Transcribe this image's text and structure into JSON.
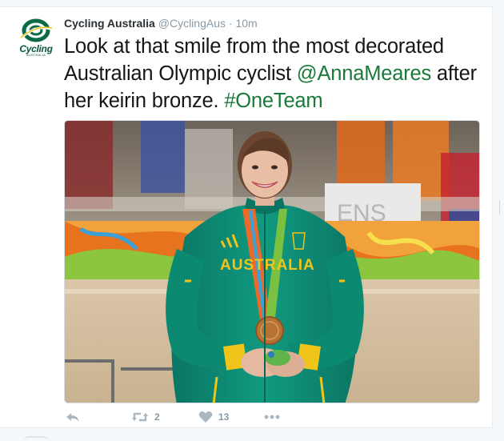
{
  "tweet": {
    "avatar_word": "Cycling",
    "avatar_sub": "AUSTRALIA",
    "name": "Cycling Australia",
    "handle": "@CyclingAus",
    "separator": "·",
    "time": "10m",
    "text_plain_1": "Look at that smile from the most decorated Australian Olympic cyclist ",
    "mention": "@AnnaMeares",
    "text_plain_2": " after her keirin bronze. ",
    "hashtag": "#OneTeam",
    "jacket_text": "AUSTRALIA",
    "banner_text": "ENS"
  },
  "actions": {
    "reply_icon": "reply-icon",
    "retweet_icon": "retweet-icon",
    "retweet_count": "2",
    "like_icon": "heart-icon",
    "like_count": "13",
    "more_icon": "more-icon"
  },
  "colors": {
    "link": "#1b7a3a",
    "action_gray": "#aab8c2",
    "jacket_green": "#0e8c74",
    "jacket_gold": "#f0c419"
  }
}
